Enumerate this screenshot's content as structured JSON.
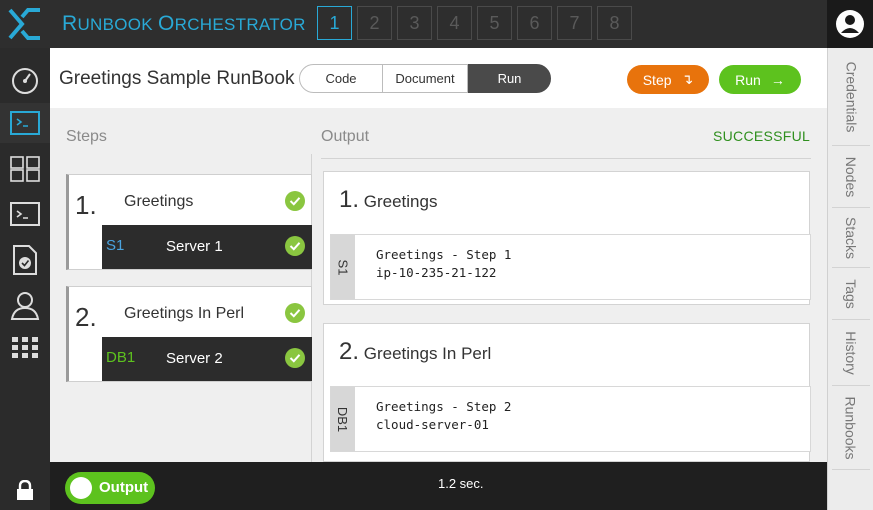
{
  "header": {
    "title_parts": [
      {
        "big": "R",
        "rest": "UNBOOK "
      },
      {
        "big": "O",
        "rest": "RCHESTRATOR"
      }
    ],
    "tabs": [
      "1",
      "2",
      "3",
      "4",
      "5",
      "6",
      "7",
      "8"
    ],
    "active_tab": "1"
  },
  "left_nav": {
    "items": [
      "dashboard-icon",
      "terminal-window-icon",
      "grid-layout-icon",
      "console-icon",
      "document-check-icon",
      "user-icon",
      "apps-grid-icon"
    ],
    "active": "terminal-window-icon",
    "bottom": "lock-icon"
  },
  "right_tabs": [
    "Credentials",
    "Nodes",
    "Stacks",
    "Tags",
    "History",
    "Runbooks"
  ],
  "runbook": {
    "title": "Greetings Sample RunBook",
    "modes": {
      "code": "Code",
      "document": "Document",
      "run": "Run"
    },
    "step_button": "Step",
    "step_button_icon": "↴",
    "run_button": "Run",
    "run_button_icon": "→"
  },
  "steps_heading": "Steps",
  "output_heading": "Output",
  "status": "SUCCESSFUL",
  "steps": [
    {
      "number": "1.",
      "name": "Greetings",
      "server_tag": "S1",
      "server_tag_color": "#4aa3df",
      "server_name": "Server 1"
    },
    {
      "number": "2.",
      "name": "Greetings In Perl",
      "server_tag": "DB1",
      "server_tag_color": "#5dc21e",
      "server_name": "Server 2"
    }
  ],
  "outputs": [
    {
      "number": "1.",
      "name": "Greetings",
      "tag": "S1",
      "lines": [
        "Greetings - Step 1",
        "ip-10-235-21-122"
      ]
    },
    {
      "number": "2.",
      "name": "Greetings In Perl",
      "tag": "DB1",
      "lines": [
        "Greetings - Step 2",
        "cloud-server-01"
      ]
    }
  ],
  "footer": {
    "toggle_label": "Output",
    "toggle_on": true,
    "timing": "1.2 sec."
  },
  "colors": {
    "accent": "#29a9d6",
    "success": "#5dc21e",
    "step_orange": "#e8730c",
    "status_green": "#2f8f1e"
  }
}
